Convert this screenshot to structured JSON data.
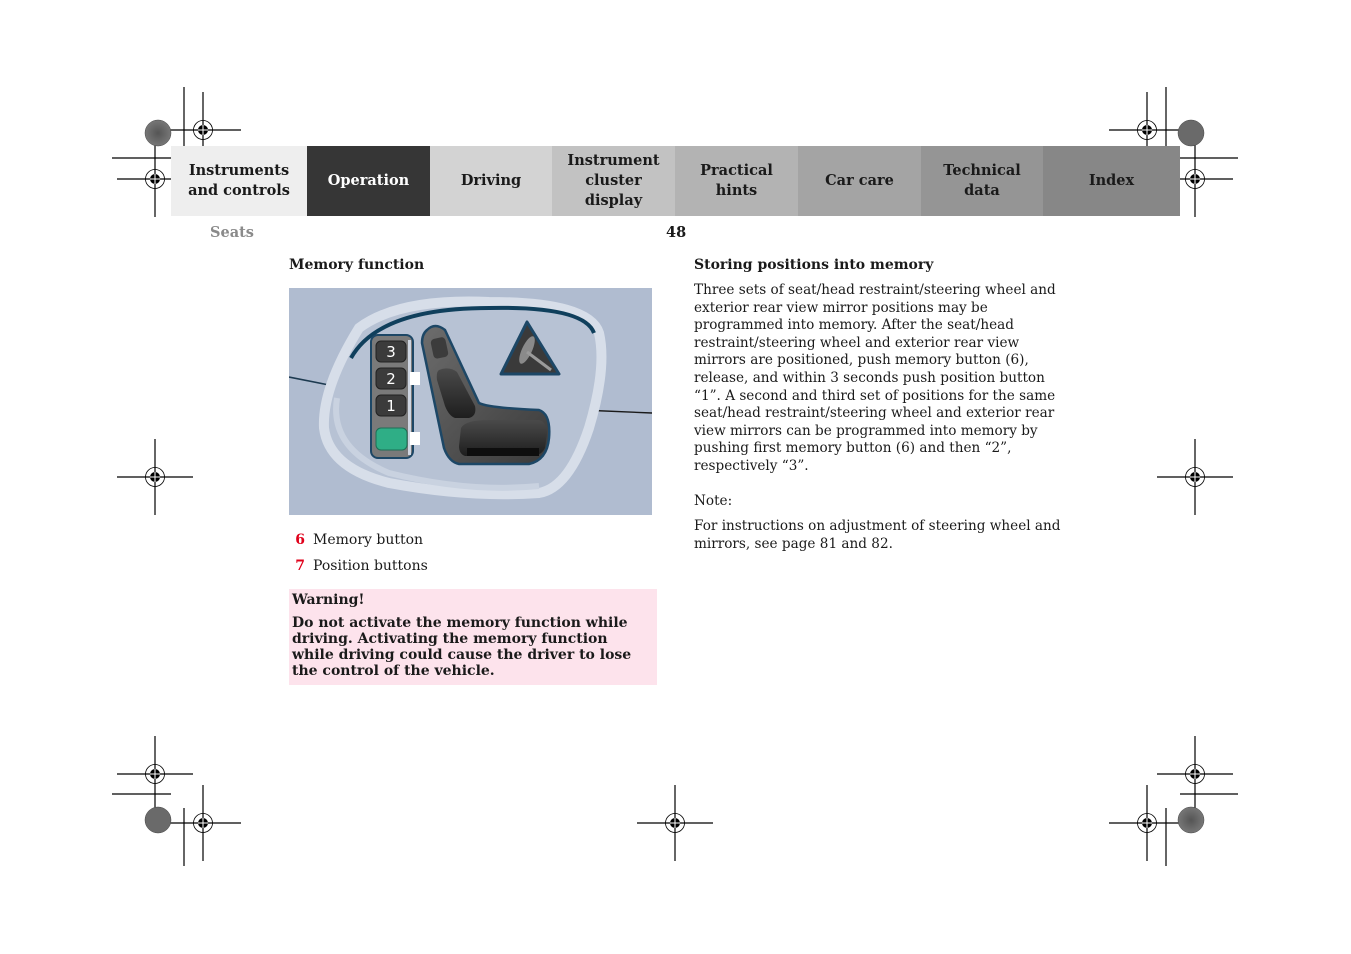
{
  "tabs": [
    {
      "label": "Instruments\nand controls",
      "active": false
    },
    {
      "label": "Operation",
      "active": true
    },
    {
      "label": "Driving",
      "active": false
    },
    {
      "label": "Instrument\ncluster display",
      "active": false
    },
    {
      "label": "Practical hints",
      "active": false
    },
    {
      "label": "Car care",
      "active": false
    },
    {
      "label": "Technical\ndata",
      "active": false
    },
    {
      "label": "Index",
      "active": false
    }
  ],
  "header": {
    "section": "Seats",
    "page_number": "48"
  },
  "left": {
    "heading": "Memory function",
    "illustration": {
      "description": "seat-control-panel",
      "position_buttons": [
        "3",
        "2",
        "1"
      ],
      "memory_button_color": "#2fae86"
    },
    "legend": [
      {
        "number": "6",
        "label": "Memory button"
      },
      {
        "number": "7",
        "label": "Position buttons"
      }
    ],
    "warning": {
      "title": "Warning!",
      "body": "Do not activate the memory function while driving. Activating the memory function while driving could cause the driver to lose the control of the vehicle."
    }
  },
  "right": {
    "heading": "Storing positions into memory",
    "paragraph": "Three sets of seat/head restraint/steering wheel and exterior rear view mirror positions may be programmed into memory. After the seat/head restraint/steering wheel and exterior rear view mirrors are positioned, push memory button (6), release, and within 3 seconds push position button “1”. A second and third set of positions for the same seat/head restraint/steering wheel and exterior rear view mirrors can be programmed into memory by pushing first memory button (6) and then “2”, respectively “3”.",
    "note_label": "Note:",
    "note_text": "For instructions on adjustment of steering wheel and mirrors, see page 81 and 82."
  },
  "colors": {
    "legend_number": "#e0001a",
    "warning_background": "#fde3ec",
    "active_tab": "#363636"
  }
}
